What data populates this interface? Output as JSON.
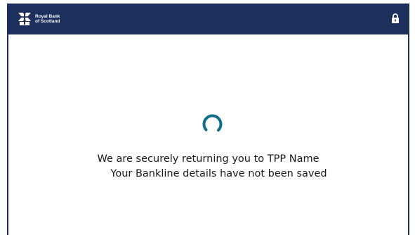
{
  "header": {
    "brand_line1": "Royal Bank",
    "brand_line2": "of Scotland",
    "brand_color": "#1d2f5c",
    "logo_icon": "rbs-daisy-logo",
    "secure_icon": "padlock-icon"
  },
  "loading": {
    "spinner_icon": "loading-spinner",
    "spinner_color": "#0f6f8a",
    "message_line1": "We are securely returning you to TPP Name",
    "message_line2": "Your Bankline details have not been saved"
  }
}
